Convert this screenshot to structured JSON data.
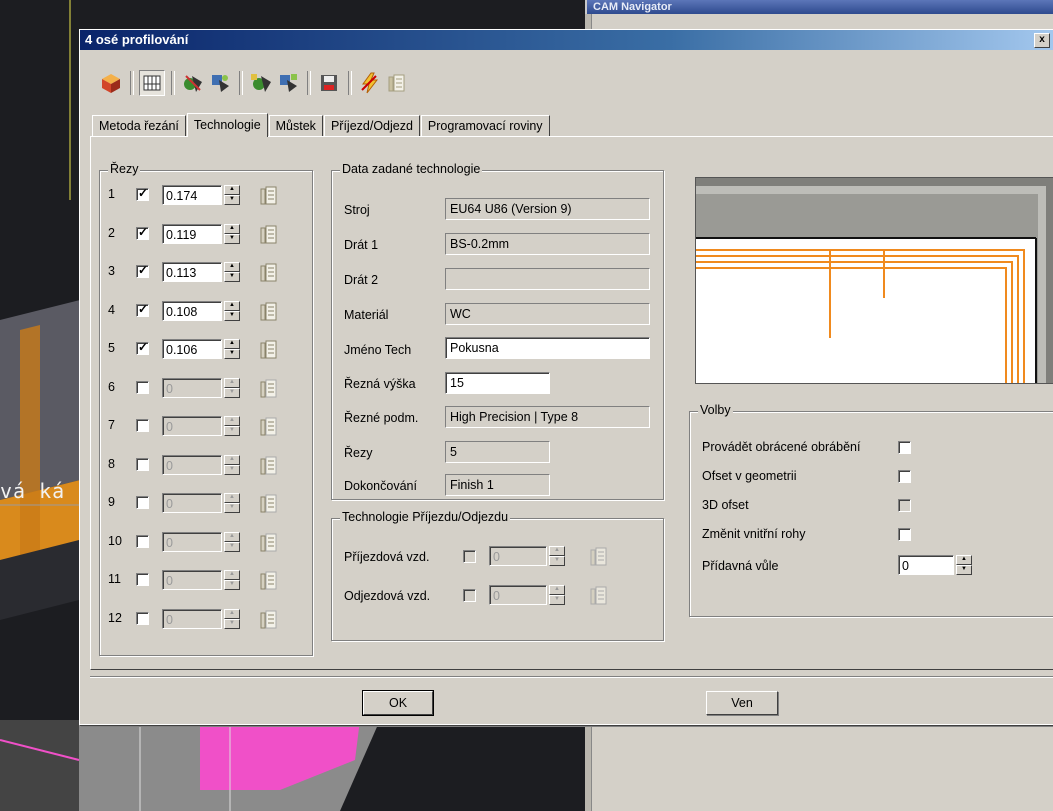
{
  "background": {
    "cam_navigator_title": "CAM Navigator",
    "canvas_text": "vá ká"
  },
  "dialog": {
    "title": "4 osé profilování",
    "close_label": "x",
    "toolbar": {
      "icons": [
        "cube-icon",
        "grid-icon",
        "wire-thread-icon",
        "wire-cut-icon",
        "wire-thread-all-icon",
        "wire-cut-all-icon",
        "save-icon",
        "flash-icon",
        "doc-icon"
      ]
    },
    "tabs": [
      {
        "label": "Metoda řezání"
      },
      {
        "label": "Technologie",
        "active": true
      },
      {
        "label": "Můstek"
      },
      {
        "label": "Příjezd/Odjezd"
      },
      {
        "label": "Programovací roviny"
      }
    ],
    "rezy": {
      "title": "Řezy",
      "rows": [
        {
          "n": "1",
          "checked": true,
          "value": "0.174"
        },
        {
          "n": "2",
          "checked": true,
          "value": "0.119"
        },
        {
          "n": "3",
          "checked": true,
          "value": "0.113"
        },
        {
          "n": "4",
          "checked": true,
          "value": "0.108"
        },
        {
          "n": "5",
          "checked": true,
          "value": "0.106"
        },
        {
          "n": "6",
          "checked": false,
          "value": "0"
        },
        {
          "n": "7",
          "checked": false,
          "value": "0"
        },
        {
          "n": "8",
          "checked": false,
          "value": "0"
        },
        {
          "n": "9",
          "checked": false,
          "value": "0"
        },
        {
          "n": "10",
          "checked": false,
          "value": "0"
        },
        {
          "n": "11",
          "checked": false,
          "value": "0"
        },
        {
          "n": "12",
          "checked": false,
          "value": "0"
        }
      ]
    },
    "technology": {
      "title": "Data zadané technologie",
      "stroj_label": "Stroj",
      "stroj": "EU64 U86 (Version 9)",
      "drat1_label": "Drát 1",
      "drat1": "BS-0.2mm",
      "drat2_label": "Drát 2",
      "drat2": "",
      "material_label": "Materiál",
      "material": "WC",
      "jmeno_label": "Jméno Tech",
      "jmeno": "Pokusna",
      "vyska_label": "Řezná výška",
      "vyska": "15",
      "podm_label": "Řezné podm.",
      "podm": "High Precision  | Type 8",
      "rezy_label": "Řezy",
      "rezy": "5",
      "dokonceni_label": "Dokončování",
      "dokonceni": "Finish 1"
    },
    "approach": {
      "title": "Technologie Příjezdu/Odjezdu",
      "prijezd_label": "Příjezdová vzd.",
      "prijezd_value": "0",
      "odjezd_label": "Odjezdová vzd.",
      "odjezd_value": "0"
    },
    "volby": {
      "title": "Volby",
      "items": [
        {
          "label": "Provádět obrácené obrábění",
          "checked": false,
          "disabled": false
        },
        {
          "label": "Ofset v geometrii",
          "checked": false,
          "disabled": false
        },
        {
          "label": "3D ofset",
          "checked": false,
          "disabled": true
        },
        {
          "label": "Změnit vnitřní rohy",
          "checked": false,
          "disabled": false
        }
      ],
      "vule_label": "Přídavná vůle",
      "vule_value": "0"
    },
    "ok_label": "OK",
    "cancel_label": "Ven"
  },
  "colors": {
    "dialog_face": "#d4d0c8",
    "title_start": "#0a246a",
    "title_end": "#a6caf0",
    "preview_path": "#f08a1e",
    "cad_magenta": "#f050c8"
  }
}
